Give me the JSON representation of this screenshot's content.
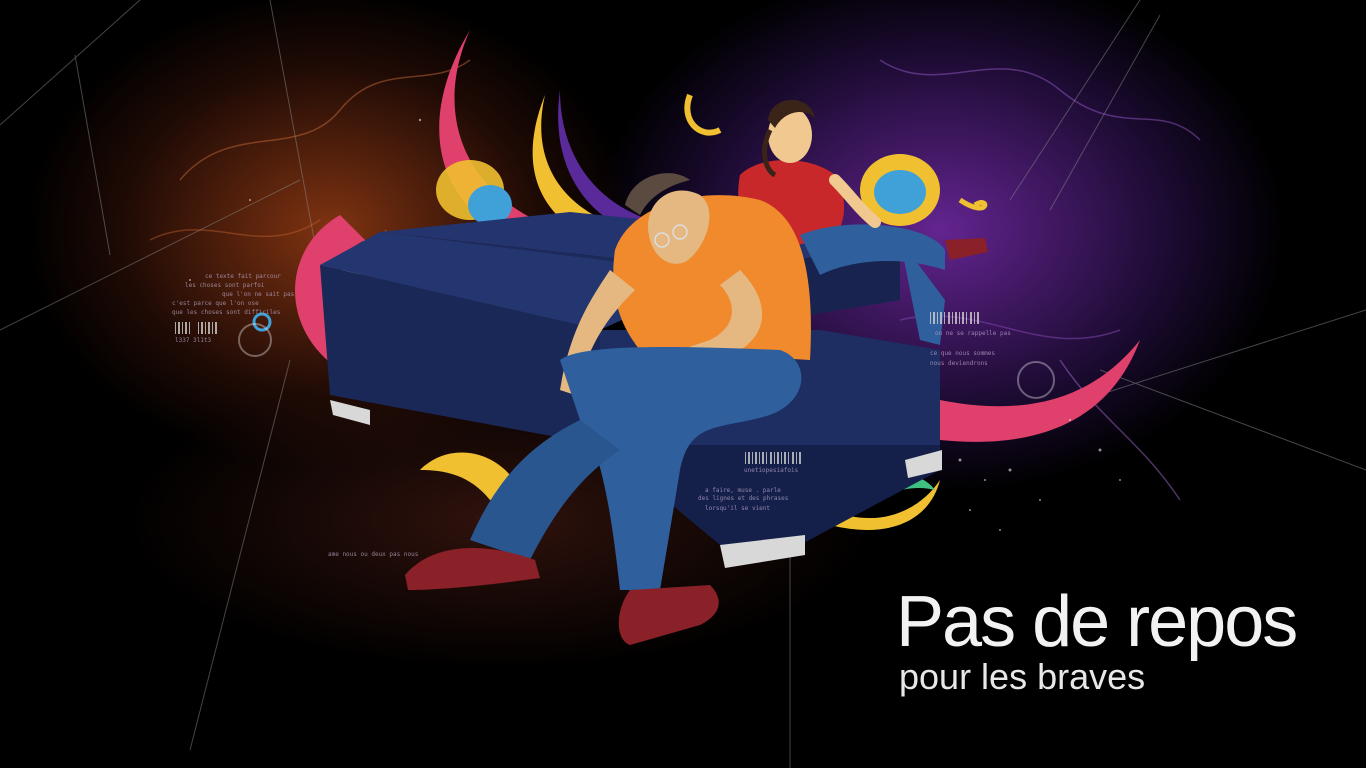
{
  "wallpaper": {
    "headline": "Pas de repos",
    "subline": "pour les braves"
  },
  "colors": {
    "background": "#000000",
    "couch": "#1c2a5c",
    "orange_shirt": "#f08a2c",
    "red_shirt": "#c8282a",
    "jeans": "#2f5f9c",
    "pink_swirl": "#e0406c",
    "purple_glow": "#6e28a0",
    "orange_glow": "#963c14",
    "text": "#f2f2f2"
  },
  "decorative_text": [
    "ce texte fait parcour",
    "les choses sont parfoi",
    "que l'on ne sait pas",
    "c'est parce que l'on ose",
    "que les choses sont difficiles",
    "l337 3l1t3",
    "unetiopesiafois",
    "on ne se rappelle pas",
    "ce que nous sommes",
    "nous deviendrons",
    "ame nous ou deux pas nous",
    "a faire, muse . parle",
    "des lignes et des phrases",
    "lorsqu'il se vient"
  ]
}
